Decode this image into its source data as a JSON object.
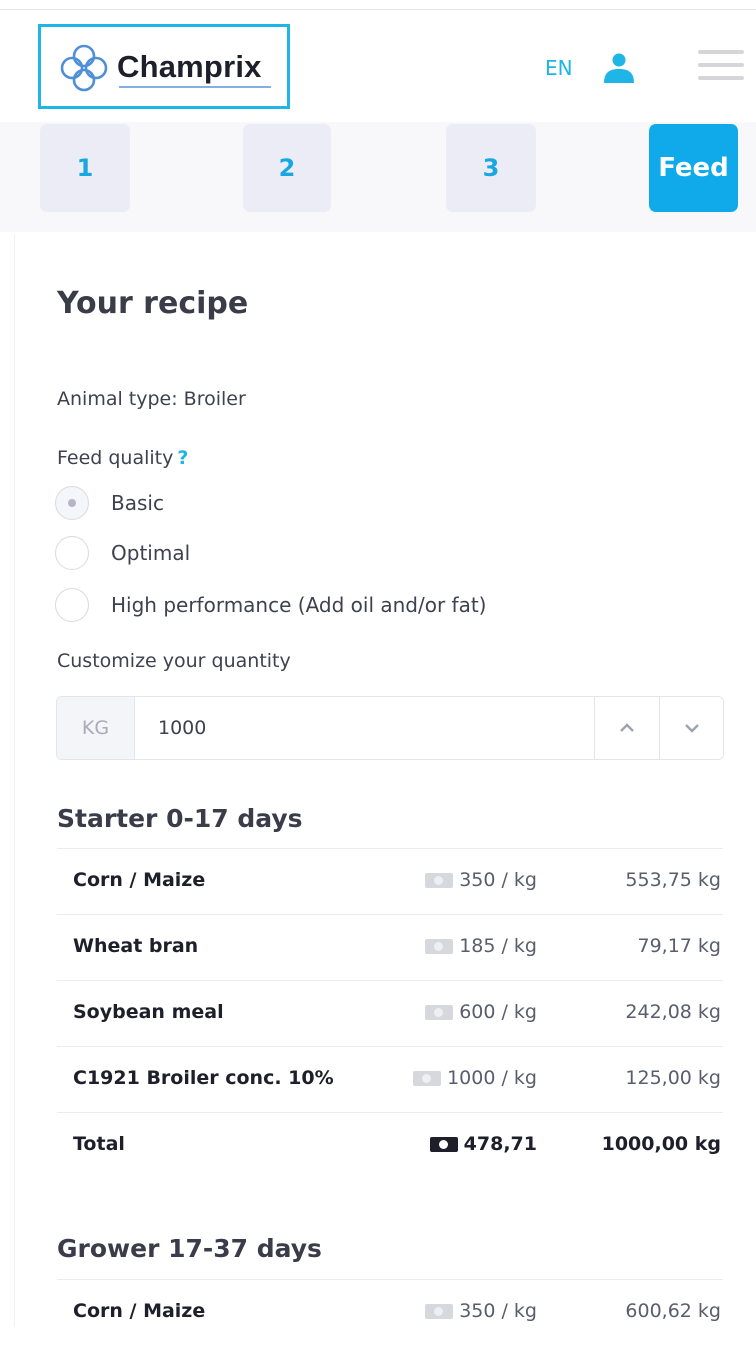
{
  "header": {
    "logo_text": "Champrix",
    "language": "EN"
  },
  "steps": [
    {
      "label": "1"
    },
    {
      "label": "2"
    },
    {
      "label": "3"
    },
    {
      "label": "Feed"
    }
  ],
  "recipe": {
    "title": "Your recipe",
    "animal_type": "Animal type: Broiler",
    "feed_quality_label": "Feed quality",
    "help_mark": "?",
    "options": [
      {
        "label": "Basic",
        "checked": true
      },
      {
        "label": "Optimal",
        "checked": false
      },
      {
        "label": "High performance (Add oil and/or fat)",
        "checked": false
      }
    ],
    "quantity_label": "Customize your quantity",
    "quantity": {
      "unit": "KG",
      "value": "1000"
    }
  },
  "sections": [
    {
      "title": "Starter 0-17 days",
      "rows": [
        {
          "name": "Corn / Maize",
          "price": "350 / kg",
          "amount": "553,75 kg"
        },
        {
          "name": "Wheat bran",
          "price": "185 / kg",
          "amount": "79,17 kg"
        },
        {
          "name": "Soybean meal",
          "price": "600 / kg",
          "amount": "242,08 kg"
        },
        {
          "name": "C1921 Broiler conc. 10%",
          "price": "1000 / kg",
          "amount": "125,00 kg"
        }
      ],
      "total": {
        "name": "Total",
        "price": "478,71",
        "amount": "1000,00 kg"
      }
    },
    {
      "title": "Grower 17-37 days",
      "rows": [
        {
          "name": "Corn / Maize",
          "price": "350 / kg",
          "amount": "600,62 kg"
        }
      ]
    }
  ],
  "colors": {
    "accent": "#10a9ea",
    "step_bg": "#ececf7"
  },
  "icons": {
    "logo": "champrix-logo-icon",
    "user": "user-icon",
    "menu": "hamburger-menu-icon",
    "up": "chevron-up-icon",
    "down": "chevron-down-icon",
    "money": "money-icon"
  }
}
